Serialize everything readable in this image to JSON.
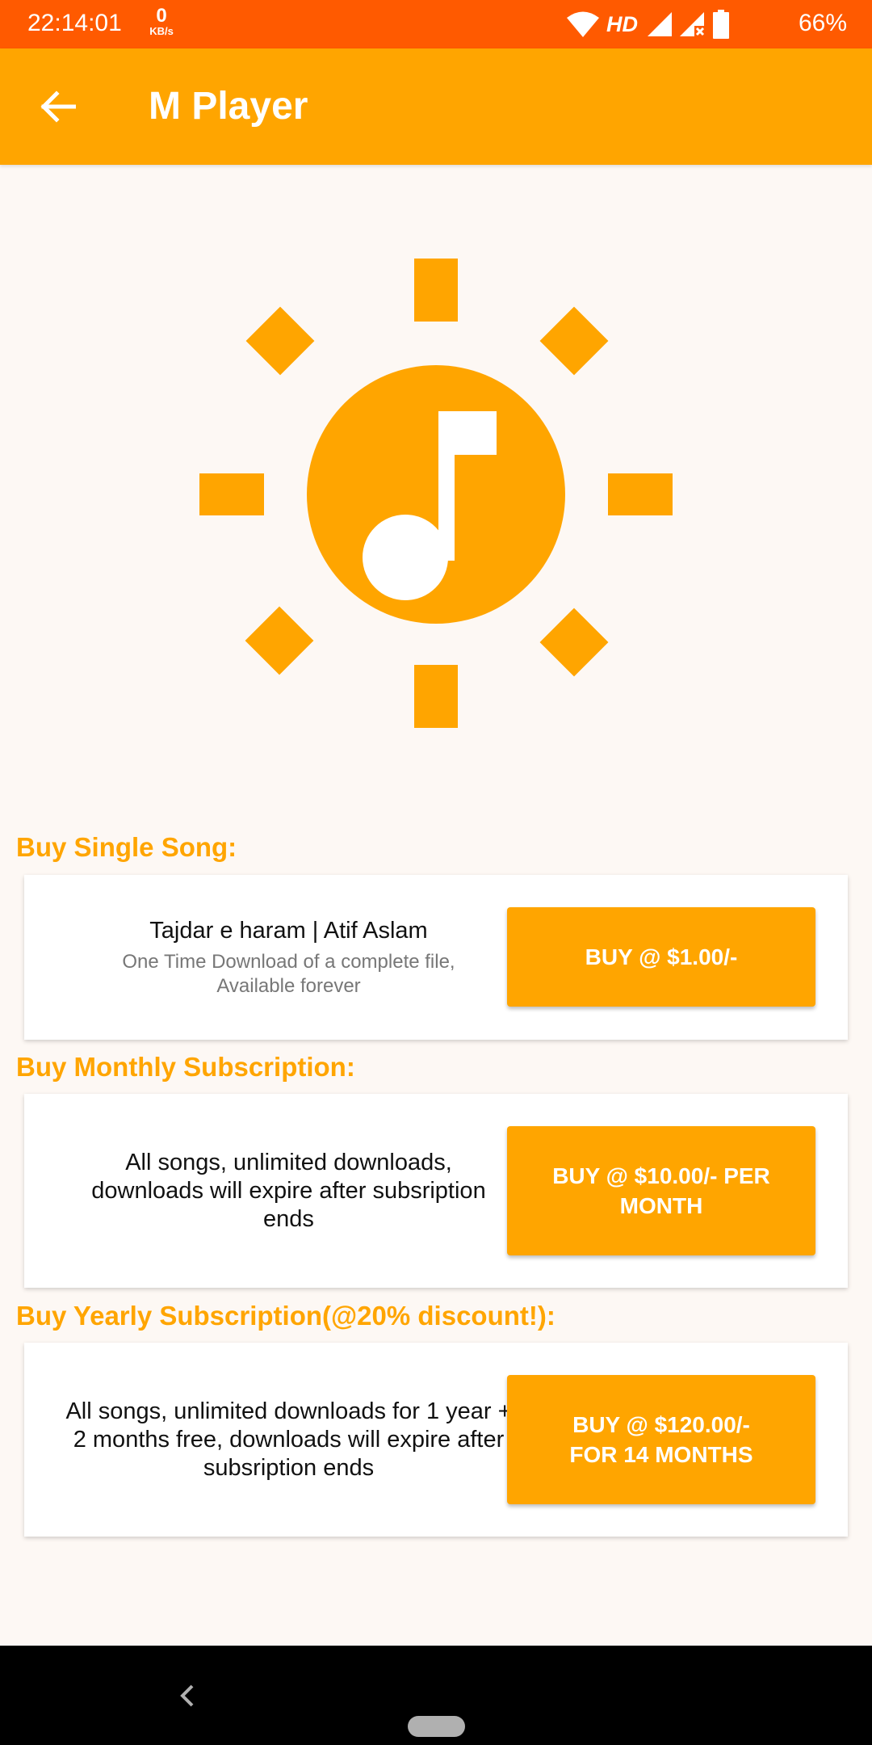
{
  "status_bar": {
    "time": "22:14:01",
    "net_speed_value": "0",
    "net_speed_unit": "KB/s",
    "network_label": "HD",
    "battery_percent": "66%",
    "icons": [
      "wifi-icon",
      "signal-icon",
      "signal-no-data-icon",
      "battery-icon"
    ]
  },
  "app_bar": {
    "title": "M Player",
    "back_icon": "arrow-back-icon"
  },
  "logo": {
    "icon": "sun-music-note-logo-icon",
    "color": "#ffa500"
  },
  "sections": [
    {
      "heading": "Buy Single Song:",
      "primary_text": "Tajdar e haram | Atif Aslam",
      "secondary_text": "One Time Download of a complete file, Available forever",
      "button_label": "BUY @ $1.00/-"
    },
    {
      "heading": "Buy Monthly Subscription:",
      "primary_text": "All songs, unlimited downloads, downloads will expire after subsription ends",
      "button_label": "BUY @ $10.00/- PER MONTH"
    },
    {
      "heading": "Buy Yearly Subscription(@20% discount!):",
      "primary_text": "All songs, unlimited downloads for 1 year + 2 months free, downloads will expire after subsription ends",
      "button_label": "BUY @ $120.00/- FOR 14 MONTHS"
    }
  ],
  "nav_bar": {
    "back_icon": "nav-back-icon",
    "home_icon": "nav-home-pill-icon"
  },
  "colors": {
    "status_bar": "#ff5a00",
    "accent": "#ffa500",
    "background": "#fdf8f4",
    "nav_bar": "#000000"
  }
}
